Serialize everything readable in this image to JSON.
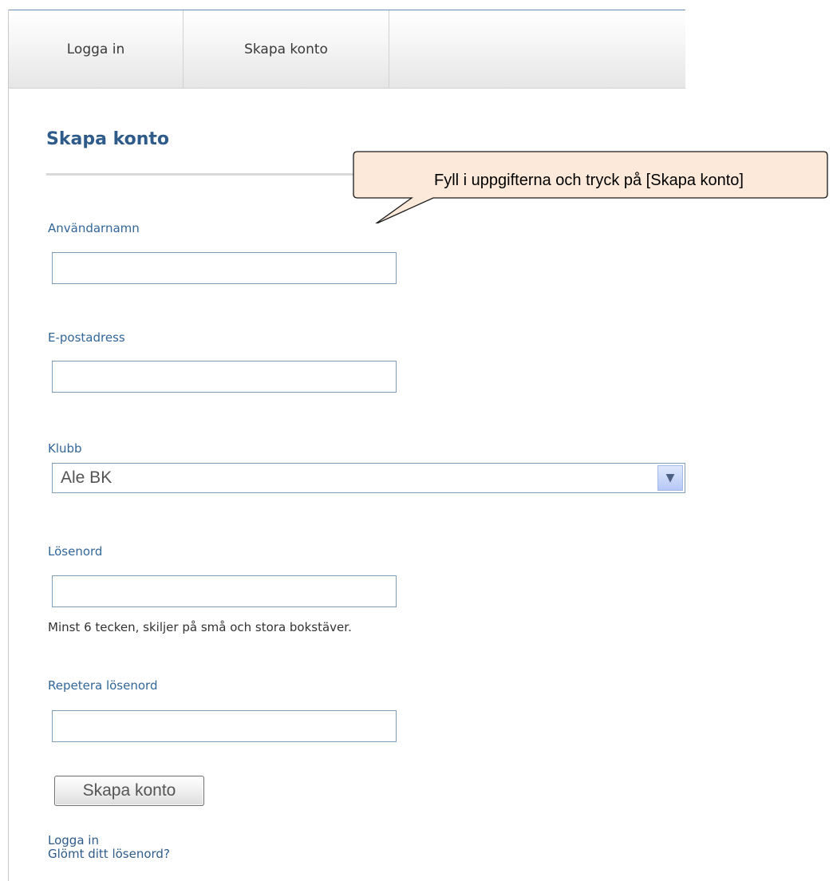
{
  "tabs": {
    "login": "Logga in",
    "create": "Skapa konto"
  },
  "form": {
    "title": "Skapa konto",
    "username_label": "Användarnamn",
    "username_value": "",
    "email_label": "E-postadress",
    "email_value": "",
    "club_label": "Klubb",
    "club_selected": "Ale BK",
    "password_label": "Lösenord",
    "password_value": "",
    "password_hint": "Minst 6 tecken, skiljer på små och stora bokstäver.",
    "repeat_password_label": "Repetera lösenord",
    "repeat_password_value": "",
    "submit_label": "Skapa konto"
  },
  "links": {
    "login": "Logga in",
    "forgot_password": "Glömt ditt lösenord?"
  },
  "callout": {
    "text": "Fyll i uppgifterna och tryck på [Skapa konto]"
  },
  "colors": {
    "accent": "#2e5b8a",
    "label": "#336699",
    "callout_fill": "#fde9d9"
  }
}
